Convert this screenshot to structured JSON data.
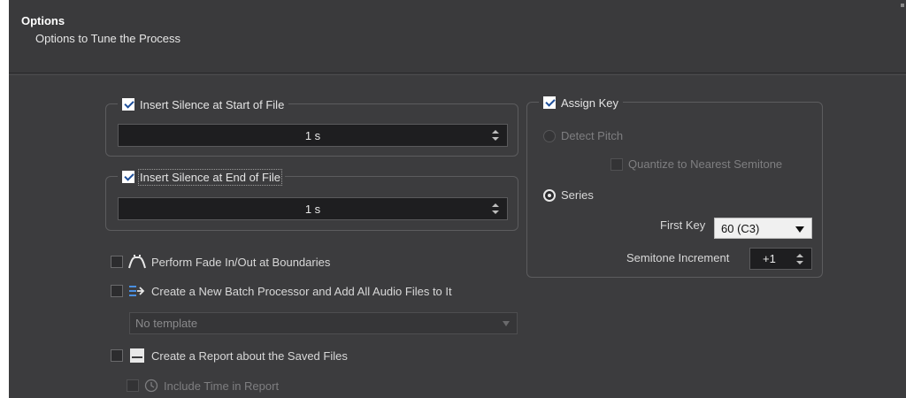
{
  "header": {
    "title": "Options",
    "subtitle": "Options to Tune the Process"
  },
  "silence_start": {
    "label": "Insert Silence at Start of File",
    "checked": true,
    "value": "1 s"
  },
  "silence_end": {
    "label": "Insert Silence at End of File",
    "checked": true,
    "value": "1 s"
  },
  "fade": {
    "label": "Perform Fade In/Out at Boundaries",
    "checked": false,
    "icon": "fade-icon"
  },
  "batch": {
    "label": "Create a New Batch Processor and Add All Audio Files to It",
    "checked": false,
    "icon": "batch-processor-icon",
    "template_value": "No template"
  },
  "report": {
    "label": "Create a Report about the Saved Files",
    "checked": false,
    "icon": "report-icon",
    "time_label": "Include Time in Report",
    "time_icon": "clock-icon"
  },
  "assign_key": {
    "label": "Assign Key",
    "checked": true,
    "detect_pitch_label": "Detect Pitch",
    "quantize_label": "Quantize to Nearest Semitone",
    "series_label": "Series",
    "selected_mode": "Series",
    "first_key_label": "First Key",
    "first_key_value": "60 (C3)",
    "semitone_label": "Semitone Increment",
    "semitone_value": "+1"
  },
  "colors": {
    "background": "#3c3c3e",
    "field": "#1e1e20",
    "checkbox_checked": "#ffffff",
    "checkmark": "#1e4f9a"
  }
}
